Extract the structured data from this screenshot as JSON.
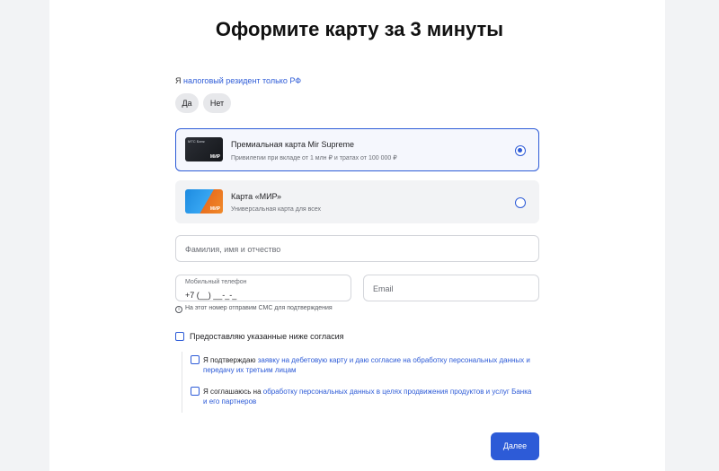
{
  "page": {
    "title": "Оформите карту за 3 минуты"
  },
  "resident": {
    "prefix": "Я",
    "link": "налоговый резидент только РФ",
    "options": [
      "Да",
      "Нет"
    ]
  },
  "cards": [
    {
      "name": "Премиальная карта Mir Supreme",
      "subtitle": "Привилегии при вкладе от 1 млн ₽ и тратах от 100 000 ₽",
      "selected": true,
      "image_mark": "МИР",
      "image_bank": "МТС Банк"
    },
    {
      "name": "Карта «МИР»",
      "subtitle": "Универсальная карта для всех",
      "selected": false,
      "image_mark": "МИР"
    }
  ],
  "form": {
    "fio_placeholder": "Фамилия, имя и отчество",
    "phone_label": "Мобильный телефон",
    "phone_value": "+7 (__) __-_-_",
    "email_placeholder": "Email",
    "phone_hint": "На этот номер отправим СМС для подтверждения"
  },
  "consents": {
    "main_label": "Предоставляю указанные ниже согласия",
    "c1_prefix": "Я подтверждаю ",
    "c1_link": "заявку на дебетовую карту и даю согласие на обработку персональных данных и передачу их третьим лицам",
    "c2_prefix": "Я соглашаюсь на ",
    "c2_link": "обработку персональных данных в целях продвижения продуктов и услуг Банка и его партнеров"
  },
  "actions": {
    "next_label": "Далее"
  },
  "colors": {
    "accent": "#2d5bd7",
    "text": "#1f1f22",
    "muted": "#6b6e75"
  }
}
